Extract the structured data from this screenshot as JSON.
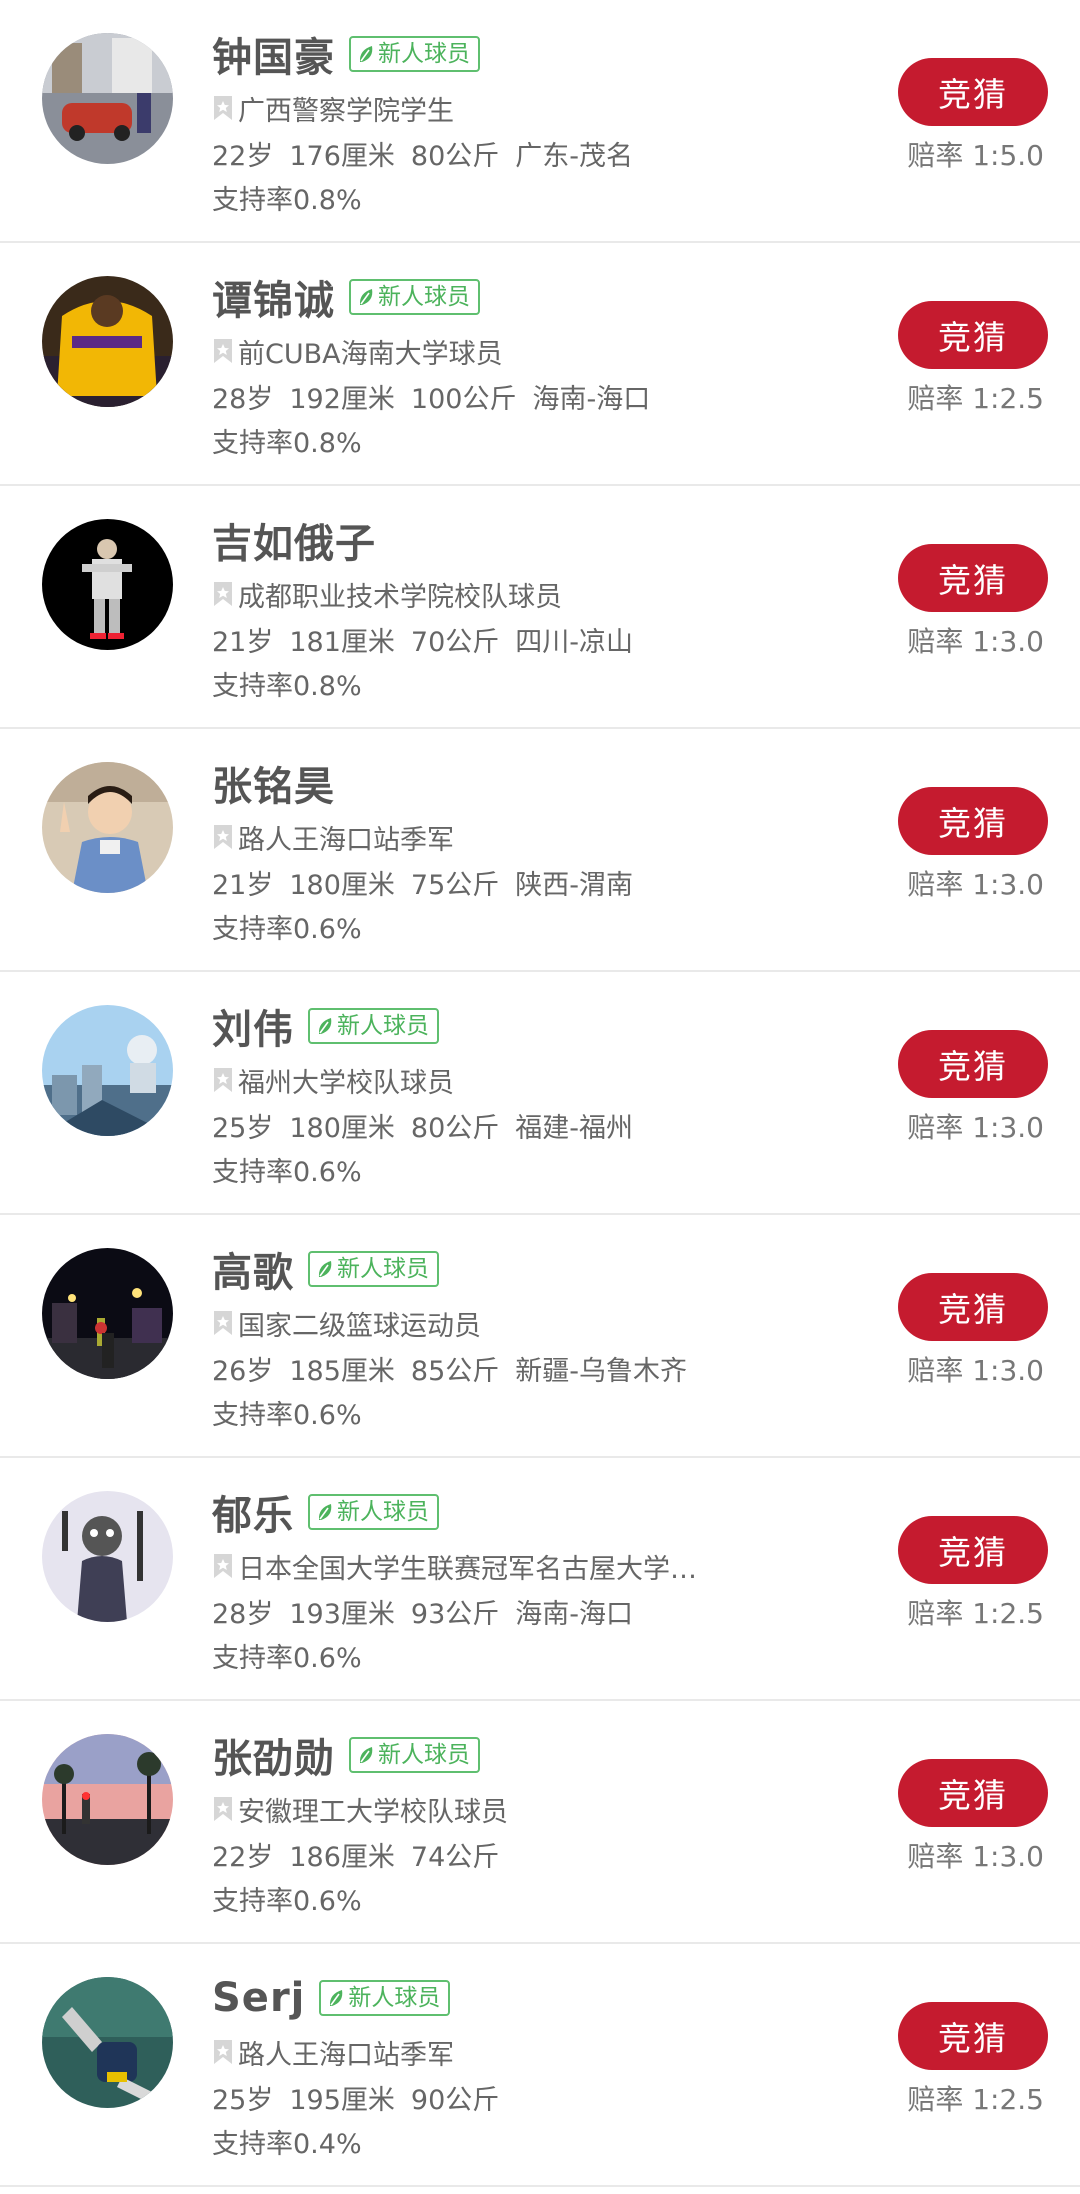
{
  "bet_label": "竞猜",
  "players": [
    {
      "name": "钟国豪",
      "new": true,
      "badge": "新人球员",
      "title": "广西警察学院学生",
      "age": "22岁",
      "height": "176厘米",
      "weight": "80公斤",
      "region": "广东-茂名",
      "support": "支持率0.8%",
      "odds": "赔率 1:5.0",
      "avatar": "street"
    },
    {
      "name": "谭锦诚",
      "new": true,
      "badge": "新人球员",
      "title": "前CUBA海南大学球员",
      "age": "28岁",
      "height": "192厘米",
      "weight": "100公斤",
      "region": "海南-海口",
      "support": "支持率0.8%",
      "odds": "赔率 1:2.5",
      "avatar": "lakers"
    },
    {
      "name": "吉如俄子",
      "new": false,
      "badge": "",
      "title": "成都职业技术学院校队球员",
      "age": "21岁",
      "height": "181厘米",
      "weight": "70公斤",
      "region": "四川-凉山",
      "support": "支持率0.8%",
      "odds": "赔率 1:3.0",
      "avatar": "dark-player"
    },
    {
      "name": "张铭昊",
      "new": false,
      "badge": "",
      "title": "路人王海口站季军",
      "age": "21岁",
      "height": "180厘米",
      "weight": "75公斤",
      "region": "陕西-渭南",
      "support": "支持率0.6%",
      "odds": "赔率 1:3.0",
      "avatar": "child"
    },
    {
      "name": "刘伟",
      "new": true,
      "badge": "新人球员",
      "title": "福州大学校队球员",
      "age": "25岁",
      "height": "180厘米",
      "weight": "80公斤",
      "region": "福建-福州",
      "support": "支持率0.6%",
      "odds": "赔率 1:3.0",
      "avatar": "sky-city"
    },
    {
      "name": "高歌",
      "new": true,
      "badge": "新人球员",
      "title": "国家二级篮球运动员",
      "age": "26岁",
      "height": "185厘米",
      "weight": "85公斤",
      "region": "新疆-乌鲁木齐",
      "support": "支持率0.6%",
      "odds": "赔率 1:3.0",
      "avatar": "night-street"
    },
    {
      "name": "郁乐",
      "new": true,
      "badge": "新人球员",
      "title": "日本全国大学生联赛冠军名古屋大学校队",
      "age": "28岁",
      "height": "193厘米",
      "weight": "93公斤",
      "region": "海南-海口",
      "support": "支持率0.6%",
      "odds": "赔率 1:2.5",
      "avatar": "painting"
    },
    {
      "name": "张劭勋",
      "new": true,
      "badge": "新人球员",
      "title": "安徽理工大学校队球员",
      "age": "22岁",
      "height": "186厘米",
      "weight": "74公斤",
      "region": "",
      "support": "支持率0.6%",
      "odds": "赔率 1:3.0",
      "avatar": "sunset"
    },
    {
      "name": "Serj",
      "new": true,
      "badge": "新人球员",
      "title": "路人王海口站季军",
      "age": "25岁",
      "height": "195厘米",
      "weight": "90公斤",
      "region": "",
      "support": "支持率0.4%",
      "odds": "赔率 1:2.5",
      "avatar": "legs"
    }
  ],
  "icons": {
    "badge": "leaf-icon",
    "title": "bookmark-icon"
  },
  "colors": {
    "bet_button": "#c51b2f",
    "badge_green": "#4cb35c"
  }
}
